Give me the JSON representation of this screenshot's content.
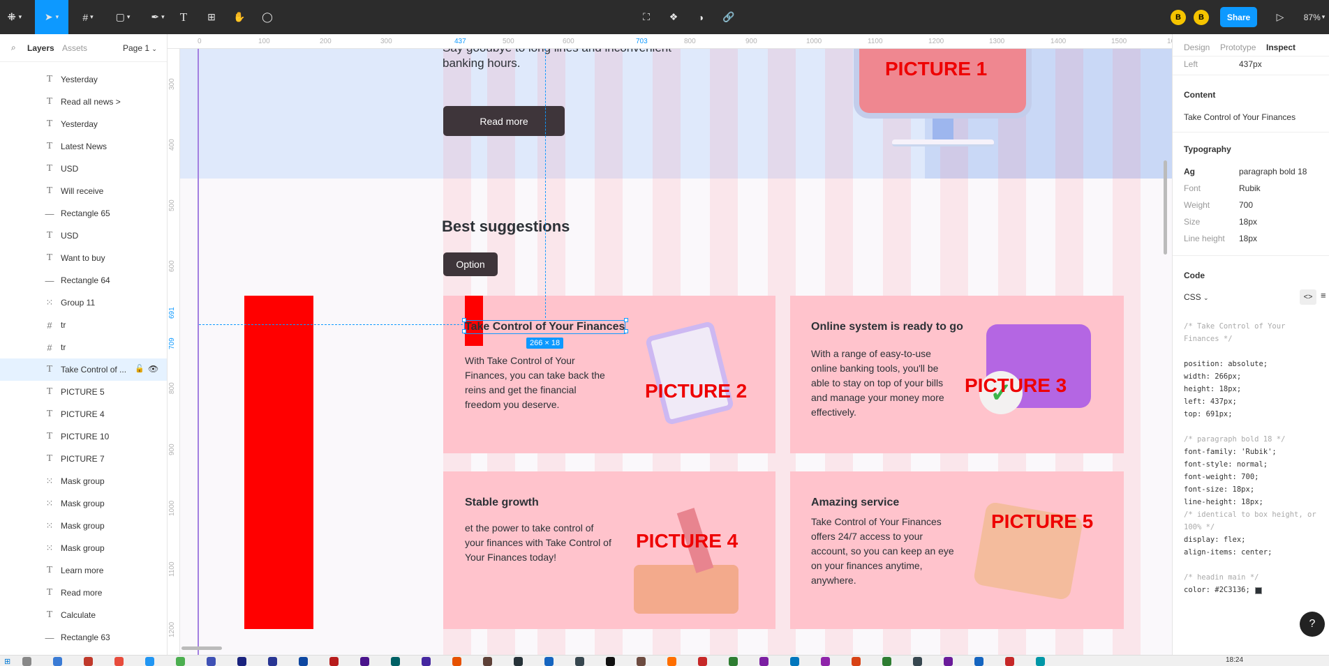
{
  "toolbar": {
    "share_label": "Share",
    "zoom": "87%",
    "avatars": [
      "B",
      "B"
    ],
    "accent": "#0d99ff"
  },
  "left_panel": {
    "tabs": [
      "Layers",
      "Assets"
    ],
    "page": "Page 1",
    "layers": [
      {
        "type": "text",
        "name": "Yesterday"
      },
      {
        "type": "text",
        "name": "Read all news >"
      },
      {
        "type": "text",
        "name": "Yesterday"
      },
      {
        "type": "text",
        "name": "Latest News"
      },
      {
        "type": "text",
        "name": "USD"
      },
      {
        "type": "text",
        "name": "Will receive"
      },
      {
        "type": "line",
        "name": "Rectangle 65"
      },
      {
        "type": "text",
        "name": "USD"
      },
      {
        "type": "text",
        "name": "Want to buy"
      },
      {
        "type": "line",
        "name": "Rectangle 64"
      },
      {
        "type": "group",
        "name": "Group 11"
      },
      {
        "type": "frame",
        "name": "tr"
      },
      {
        "type": "frame",
        "name": "tr"
      },
      {
        "type": "text",
        "name": "Take Control of ...",
        "selected": true
      },
      {
        "type": "text",
        "name": "PICTURE 5"
      },
      {
        "type": "text",
        "name": "PICTURE 4"
      },
      {
        "type": "text",
        "name": "PICTURE 10"
      },
      {
        "type": "text",
        "name": "PICTURE 7"
      },
      {
        "type": "group",
        "name": "Mask group"
      },
      {
        "type": "group",
        "name": "Mask group"
      },
      {
        "type": "group",
        "name": "Mask group"
      },
      {
        "type": "group",
        "name": "Mask group"
      },
      {
        "type": "text",
        "name": "Learn more"
      },
      {
        "type": "text",
        "name": "Read more"
      },
      {
        "type": "text",
        "name": "Calculate"
      },
      {
        "type": "line",
        "name": "Rectangle 63"
      }
    ]
  },
  "rulers": {
    "x_ticks": [
      "0",
      "100",
      "200",
      "300",
      "437",
      "500",
      "600",
      "703",
      "800",
      "900",
      "1000",
      "1100",
      "1200",
      "1300",
      "1400",
      "1500",
      "16"
    ],
    "y_ticks": [
      "300",
      "400",
      "500",
      "600",
      "691",
      "709",
      "800",
      "900",
      "1000",
      "1100",
      "1200"
    ]
  },
  "canvas": {
    "hero": {
      "text_line1": "Say goodbye to long lines and inconvenient",
      "text_line2": "banking hours.",
      "read_more": "Read more",
      "picture": "PICTURE 1"
    },
    "section_title": "Best suggestions",
    "option_button": "Option",
    "selection_badge": "266 × 18",
    "cards": [
      {
        "title": "Take Control of Your Finances",
        "body": "With Take Control of Your Finances, you can take back the reins and get the financial freedom you deserve.",
        "picture": "PICTURE 2"
      },
      {
        "title": "Online system is ready to go",
        "body": " With a range of easy-to-use online banking tools, you'll be able to stay on top of your bills and manage your money more effectively.",
        "picture": "PICTURE 3"
      },
      {
        "title": "Stable growth",
        "body": "et the power to take control of your finances with Take Control of Your Finances today!",
        "picture": "PICTURE 4"
      },
      {
        "title": "Amazing service",
        "body": "Take Control of Your Finances offers 24/7 access to your account, so you can keep an eye on your finances anytime, anywhere.",
        "picture": "PICTURE 5"
      }
    ]
  },
  "right_panel": {
    "tabs": [
      "Design",
      "Prototype",
      "Inspect"
    ],
    "left_label": "Left",
    "left_value": "437px",
    "content_heading": "Content",
    "content_value": "Take Control of Your Finances",
    "typography_heading": "Typography",
    "style_label": "Ag",
    "style_name": "paragraph bold 18",
    "props": [
      {
        "key": "Font",
        "value": "Rubik"
      },
      {
        "key": "Weight",
        "value": "700"
      },
      {
        "key": "Size",
        "value": "18px"
      },
      {
        "key": "Line height",
        "value": "18px"
      }
    ],
    "code_heading": "Code",
    "code_lang": "CSS",
    "code_lines": [
      "/* Take Control of Your",
      "Finances */",
      "",
      "position: absolute;",
      "width: 266px;",
      "height: 18px;",
      "left: 437px;",
      "top: 691px;",
      "",
      "/* paragraph bold 18 */",
      "font-family: 'Rubik';",
      "font-style: normal;",
      "font-weight: 700;",
      "font-size: 18px;",
      "line-height: 18px;",
      "/* identical to box height, or",
      "100% */",
      "display: flex;",
      "align-items: center;",
      "",
      "/* headin main */",
      "color: #2C3136;"
    ],
    "swatch_color": "#2c3136"
  },
  "taskbar": {
    "time": "18:24"
  }
}
